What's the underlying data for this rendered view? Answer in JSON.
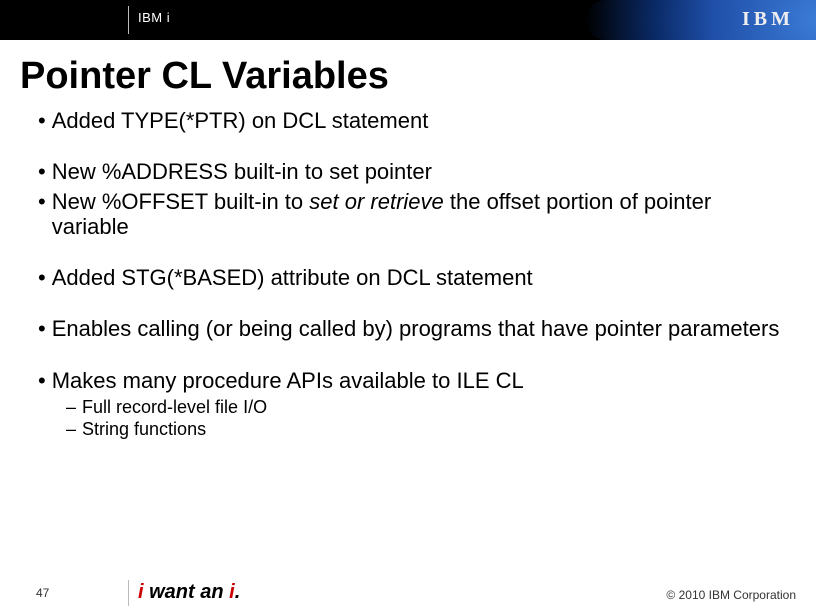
{
  "header": {
    "product": "IBM i",
    "logo": "IBM"
  },
  "title": "Pointer CL Variables",
  "bullets": {
    "b1": "Added TYPE(*PTR) on DCL statement",
    "b2": "New %ADDRESS built-in to set pointer",
    "b3_a": "New %OFFSET built-in to ",
    "b3_i": "set or retrieve",
    "b3_b": " the offset portion of pointer variable",
    "b4": "Added STG(*BASED) attribute on DCL statement",
    "b5": "Enables calling (or being called by) programs that have pointer parameters",
    "b6": "Makes many procedure APIs available to ILE CL",
    "s1": "Full record-level file I/O",
    "s2": "String functions"
  },
  "footer": {
    "page": "47",
    "tag_i1": "i",
    "tag_mid": " want an ",
    "tag_i2": "i",
    "tag_dot": ".",
    "copyright": "© 2010 IBM Corporation"
  }
}
